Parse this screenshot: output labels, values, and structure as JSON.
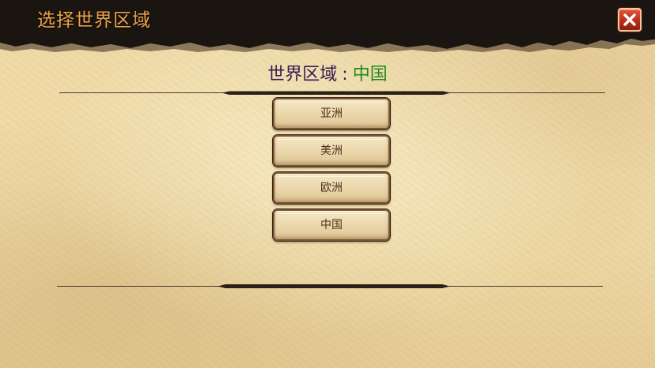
{
  "header": {
    "title": "选择世界区域"
  },
  "region": {
    "label": "世界区域",
    "separator": ":",
    "current": "中国"
  },
  "regions": [
    {
      "label": "亚洲"
    },
    {
      "label": "美洲"
    },
    {
      "label": "欧洲"
    },
    {
      "label": "中国"
    }
  ],
  "colors": {
    "title": "#e9a24a",
    "region_label": "#3a1a52",
    "region_value": "#1f8a1c",
    "close_button": "#c23a22",
    "parchment": "#efd9a6"
  },
  "icons": {
    "close": "close-icon"
  }
}
